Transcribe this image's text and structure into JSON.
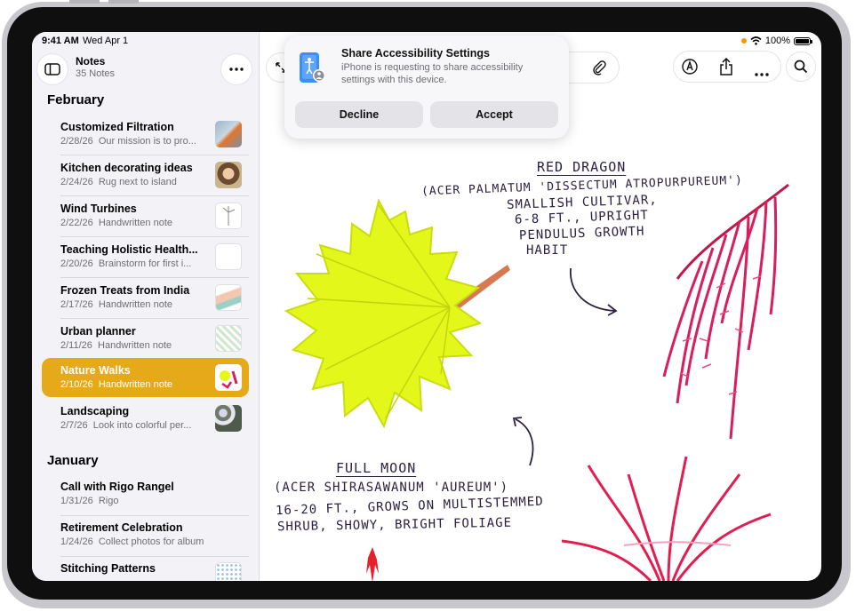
{
  "status_bar": {
    "time": "9:41 AM",
    "date": "Wed Apr 1",
    "battery": "100%"
  },
  "sidebar": {
    "title": "Notes",
    "count": "35 Notes",
    "sections": [
      {
        "label": "February",
        "notes": [
          {
            "title": "Customized Filtration",
            "date": "2/28/26",
            "preview": "Our mission is to pro..."
          },
          {
            "title": "Kitchen decorating ideas",
            "date": "2/24/26",
            "preview": "Rug next to island"
          },
          {
            "title": "Wind Turbines",
            "date": "2/22/26",
            "preview": "Handwritten note"
          },
          {
            "title": "Teaching Holistic Health...",
            "date": "2/20/26",
            "preview": "Brainstorm for first i..."
          },
          {
            "title": "Frozen Treats from India",
            "date": "2/17/26",
            "preview": "Handwritten note"
          },
          {
            "title": "Urban planner",
            "date": "2/11/26",
            "preview": "Handwritten note"
          },
          {
            "title": "Nature Walks",
            "date": "2/10/26",
            "preview": "Handwritten note",
            "selected": true
          },
          {
            "title": "Landscaping",
            "date": "2/7/26",
            "preview": "Look into colorful per..."
          }
        ]
      },
      {
        "label": "January",
        "notes": [
          {
            "title": "Call with Rigo Rangel",
            "date": "1/31/26",
            "preview": "Rigo"
          },
          {
            "title": "Retirement Celebration",
            "date": "1/24/26",
            "preview": "Collect photos for album"
          },
          {
            "title": "Stitching Patterns",
            "date": "",
            "preview": ""
          }
        ]
      }
    ]
  },
  "dialog": {
    "title": "Share Accessibility Settings",
    "message": "iPhone is requesting to share accessibility settings with this device.",
    "decline_label": "Decline",
    "accept_label": "Accept"
  },
  "canvas": {
    "red_dragon": {
      "title": "RED DRAGON",
      "lines": [
        "(ACER PALMATUM 'DISSECTUM ATROPURPUREUM')",
        "SMALLISH CULTIVAR,",
        "6-8 FT., UPRIGHT",
        "PENDULUS GROWTH",
        "HABIT"
      ]
    },
    "full_moon": {
      "title": "FULL MOON",
      "lines": [
        "(ACER SHIRASAWANUM 'AUREUM')",
        "16-20 FT., GROWS ON MULTISTEMMED",
        "SHRUB, SHOWY, BRIGHT FOLIAGE"
      ]
    }
  },
  "icons": {
    "sidebar_toggle": "sidebar-icon",
    "more": "ellipsis-icon",
    "collapse": "arrows-icon",
    "attach": "paperclip-icon",
    "markup": "pen-circle-icon",
    "share": "share-icon",
    "search": "magnifier-icon",
    "accessibility": "accessibility-icon"
  },
  "colors": {
    "accent": "#e6a91a",
    "leaf_yellow": "#e4f71a",
    "leaf_red": "#d81e5b",
    "ink": "#2b2140"
  }
}
